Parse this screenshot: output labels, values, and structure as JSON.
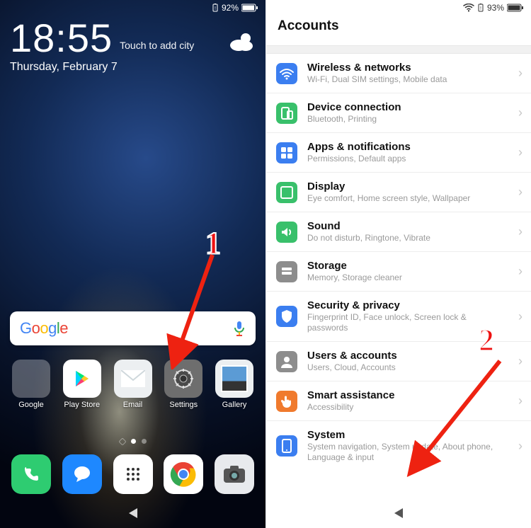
{
  "annotations": {
    "step1": "1",
    "step2": "2"
  },
  "home": {
    "status": {
      "battery_pct": "92%"
    },
    "clock": {
      "time": "18:55",
      "city_hint": "Touch to add city",
      "date": "Thursday, February 7"
    },
    "search": {
      "logo_letters": [
        "G",
        "o",
        "o",
        "g",
        "l",
        "e"
      ]
    },
    "apps": [
      {
        "label": "Google"
      },
      {
        "label": "Play Store"
      },
      {
        "label": "Email"
      },
      {
        "label": "Settings"
      },
      {
        "label": "Gallery"
      }
    ],
    "dock": [
      {
        "name": "phone"
      },
      {
        "name": "messages"
      },
      {
        "name": "app-drawer"
      },
      {
        "name": "chrome"
      },
      {
        "name": "camera"
      }
    ]
  },
  "settings": {
    "status": {
      "battery_pct": "93%"
    },
    "header": "Accounts",
    "items": [
      {
        "title": "Wireless & networks",
        "sub": "Wi-Fi, Dual SIM settings, Mobile data",
        "color": "#3b7ef0",
        "icon": "wifi"
      },
      {
        "title": "Device connection",
        "sub": "Bluetooth, Printing",
        "color": "#39c06b",
        "icon": "device"
      },
      {
        "title": "Apps & notifications",
        "sub": "Permissions, Default apps",
        "color": "#3b7ef0",
        "icon": "apps"
      },
      {
        "title": "Display",
        "sub": "Eye comfort, Home screen style, Wallpaper",
        "color": "#39c06b",
        "icon": "display"
      },
      {
        "title": "Sound",
        "sub": "Do not disturb, Ringtone, Vibrate",
        "color": "#39c06b",
        "icon": "sound"
      },
      {
        "title": "Storage",
        "sub": "Memory, Storage cleaner",
        "color": "#8d8d8d",
        "icon": "storage"
      },
      {
        "title": "Security & privacy",
        "sub": "Fingerprint ID, Face unlock, Screen lock & passwords",
        "color": "#3b7ef0",
        "icon": "shield"
      },
      {
        "title": "Users & accounts",
        "sub": "Users, Cloud, Accounts",
        "color": "#8d8d8d",
        "icon": "users"
      },
      {
        "title": "Smart assistance",
        "sub": "Accessibility",
        "color": "#f07a2d",
        "icon": "hand"
      },
      {
        "title": "System",
        "sub": "System navigation, System update, About phone, Language & input",
        "color": "#3b7ef0",
        "icon": "system"
      }
    ]
  }
}
